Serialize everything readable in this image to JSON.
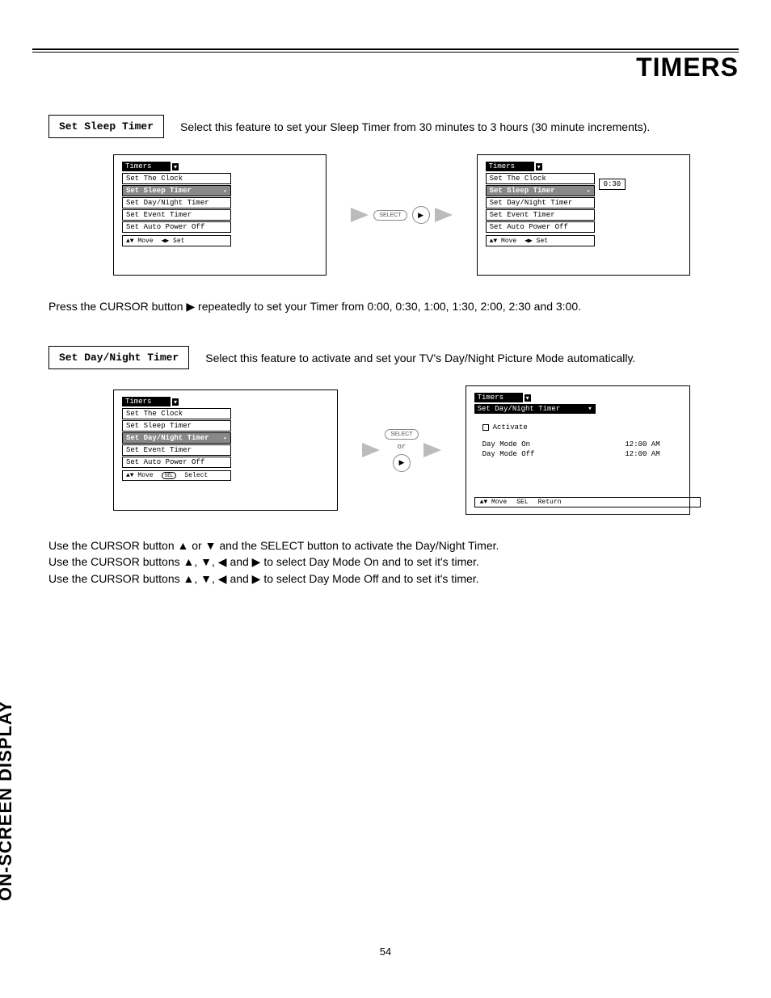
{
  "page": {
    "title": "TIMERS",
    "side_label": "ON-SCREEN DISPLAY",
    "number": "54"
  },
  "sleep": {
    "box_label": "Set Sleep Timer",
    "desc": "Select this feature to set your Sleep Timer from 30 minutes to 3 hours (30 minute increments).",
    "instruction": "Press the CURSOR button ▶ repeatedly to set your Timer from 0:00, 0:30, 1:00, 1:30, 2:00, 2:30 and 3:00.",
    "value": "0:30",
    "panel_title": "Timers",
    "items": [
      "Set The Clock",
      "Set Sleep Timer",
      "Set Day/Night Timer",
      "Set Event Timer",
      "Set Auto Power Off"
    ],
    "highlight_index": 1,
    "footer_left": {
      "move": "Move",
      "set": "Set"
    },
    "select_label": "SELECT"
  },
  "daynight": {
    "box_label": "Set Day/Night Timer",
    "desc": "Select this feature to activate and set your TV's Day/Night Picture Mode automatically.",
    "instructions": [
      "Use the CURSOR button ▲ or ▼ and the SELECT button to activate the Day/Night Timer.",
      "Use the CURSOR buttons ▲, ▼, ◀ and ▶ to select Day Mode On and to set it's timer.",
      "Use the CURSOR buttons ▲, ▼, ◀ and ▶ to select Day Mode Off and to set it's timer."
    ],
    "panel_title": "Timers",
    "items": [
      "Set The Clock",
      "Set Sleep Timer",
      "Set Day/Night Timer",
      "Set Event Timer",
      "Set Auto Power Off"
    ],
    "highlight_index": 2,
    "footer_left": {
      "move": "Move",
      "select": "Select",
      "sel_btn": "SEL"
    },
    "select_label": "SELECT",
    "or": "or",
    "right_panel": {
      "title_menu": "Timers",
      "subtitle": "Set Day/Night Timer",
      "activate": "Activate",
      "rows": [
        {
          "label": "Day Mode On",
          "time": "12:00 AM"
        },
        {
          "label": "Day Mode Off",
          "time": "12:00 AM"
        }
      ],
      "footer": {
        "move": "Move",
        "ret_btn": "SEL",
        "return": "Return"
      }
    }
  }
}
